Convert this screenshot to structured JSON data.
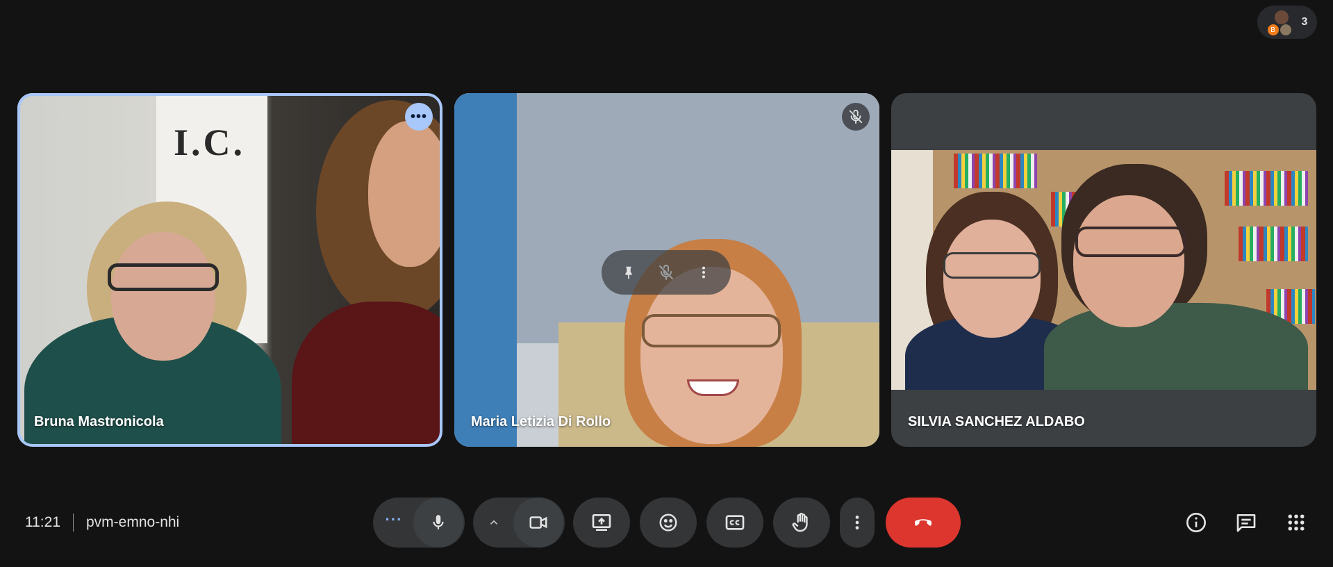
{
  "participants_panel": {
    "count": "3",
    "avatar_initial": "B"
  },
  "tiles": [
    {
      "name": "Bruna Mastronicola",
      "banner_text": "I.C.",
      "active": true,
      "has_more_menu": true
    },
    {
      "name": "Maria Letizia Di Rollo",
      "muted": true,
      "hover_controls": [
        "pin-icon",
        "mic-off-icon",
        "more-vert-icon"
      ]
    },
    {
      "name": "SILVIA SANCHEZ ALDABO"
    }
  ],
  "meeting": {
    "time": "11:21",
    "code": "pvm-emno-nhi"
  },
  "controls": {
    "audio_options": "more-horiz-icon",
    "mic": "mic-icon",
    "video_options": "chevron-up-icon",
    "camera": "videocam-icon",
    "present": "present-screen-icon",
    "reactions": "emoji-icon",
    "captions": "closed-caption-icon",
    "raise_hand": "hand-icon",
    "more": "more-vert-icon",
    "end_call": "call-end-icon"
  },
  "right_panel": [
    "info-icon",
    "chat-icon",
    "apps-grid-icon"
  ],
  "colors": {
    "accent": "#a8c7fa",
    "end_call": "#dc362e",
    "background": "#131314"
  }
}
